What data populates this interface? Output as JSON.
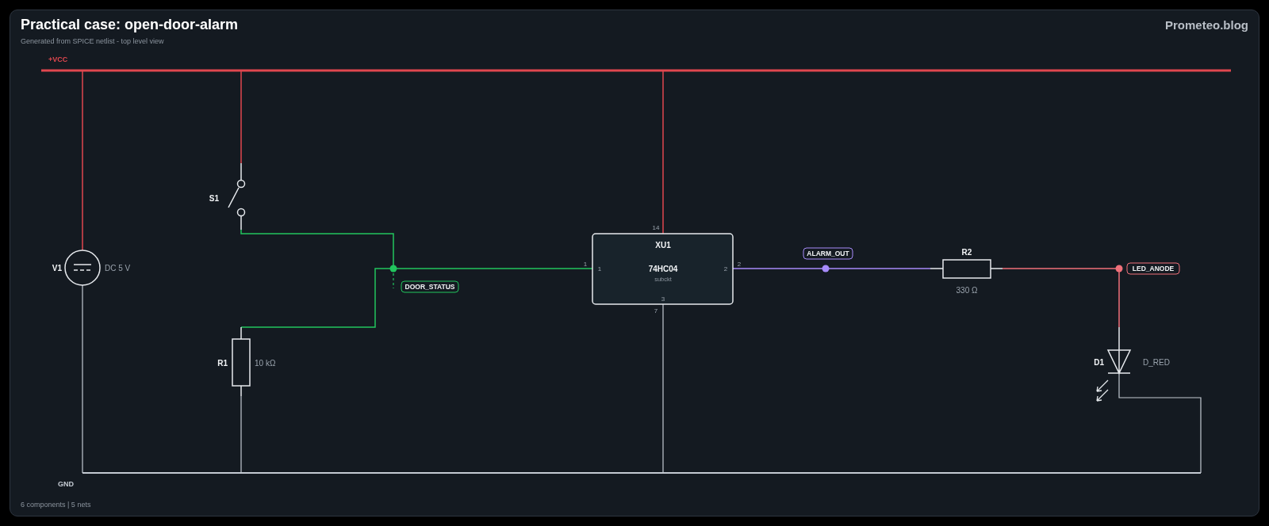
{
  "header": {
    "title": "Practical case: open-door-alarm",
    "subtitle": "Generated from SPICE netlist - top level view",
    "brand": "Prometeo.blog"
  },
  "nets": [
    {
      "name": "+VCC",
      "kind": "rail",
      "color": "#e0474f"
    },
    {
      "name": "DOOR_STATUS",
      "kind": "tag",
      "color": "#22c55e"
    },
    {
      "name": "ALARM_OUT",
      "kind": "tag",
      "color": "#a78bfa"
    },
    {
      "name": "LED_ANODE",
      "kind": "tag",
      "color": "#f0707a"
    },
    {
      "name": "GND",
      "kind": "rail",
      "color": "#c4cad2"
    }
  ],
  "components": [
    {
      "kind": "source",
      "ref": "V1",
      "value": "DC 5 V"
    },
    {
      "kind": "switch",
      "ref": "S1"
    },
    {
      "kind": "resistor",
      "ref": "R1",
      "value": "10 kΩ"
    },
    {
      "kind": "ic",
      "ref": "XU1",
      "value": "74HC04",
      "note": "subckt",
      "pins": [
        {
          "outer": "14"
        },
        {
          "outer": "1",
          "inner": "1"
        },
        {
          "outer": "2",
          "inner": "2"
        },
        {
          "outer": "7",
          "inner": "3"
        }
      ]
    },
    {
      "kind": "resistor",
      "ref": "R2",
      "value": "330 Ω"
    },
    {
      "kind": "led",
      "ref": "D1",
      "value": "D_RED"
    }
  ],
  "footer": "6 components | 5 nets"
}
